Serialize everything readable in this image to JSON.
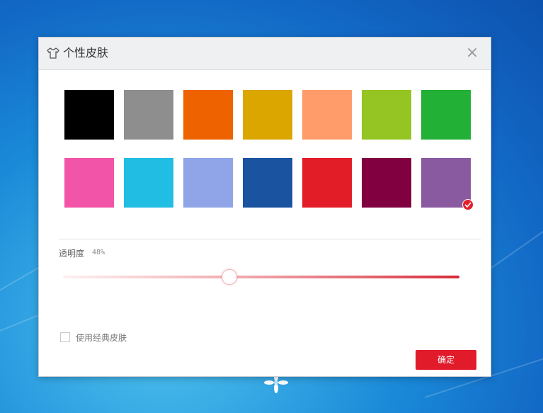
{
  "dialog": {
    "title": "个性皮肤",
    "close_glyph": "×"
  },
  "swatches": [
    {
      "name": "black",
      "color": "#000000"
    },
    {
      "name": "gray",
      "color": "#8e8e8e"
    },
    {
      "name": "orange",
      "color": "#ee6300"
    },
    {
      "name": "gold",
      "color": "#dba600"
    },
    {
      "name": "light-orange",
      "color": "#ff9c6a"
    },
    {
      "name": "lime",
      "color": "#95c522"
    },
    {
      "name": "green",
      "color": "#22b036"
    },
    {
      "name": "pink",
      "color": "#f255a8"
    },
    {
      "name": "cyan",
      "color": "#22bde2"
    },
    {
      "name": "lavender",
      "color": "#8fa5e7"
    },
    {
      "name": "navy",
      "color": "#1a539f"
    },
    {
      "name": "red",
      "color": "#e21d27"
    },
    {
      "name": "maroon",
      "color": "#810040"
    },
    {
      "name": "purple",
      "color": "#8a5aa0",
      "selected": true
    }
  ],
  "opacity": {
    "label": "透明度",
    "value_text": "48%",
    "value": 0.42
  },
  "classic_skin": {
    "label": "使用经典皮肤",
    "checked": false
  },
  "ok_button": {
    "label": "确定"
  },
  "icons": {
    "title": "tshirt-icon",
    "close": "close-icon",
    "selected": "checkmark-icon",
    "desktop_logo": "logo-icon"
  }
}
